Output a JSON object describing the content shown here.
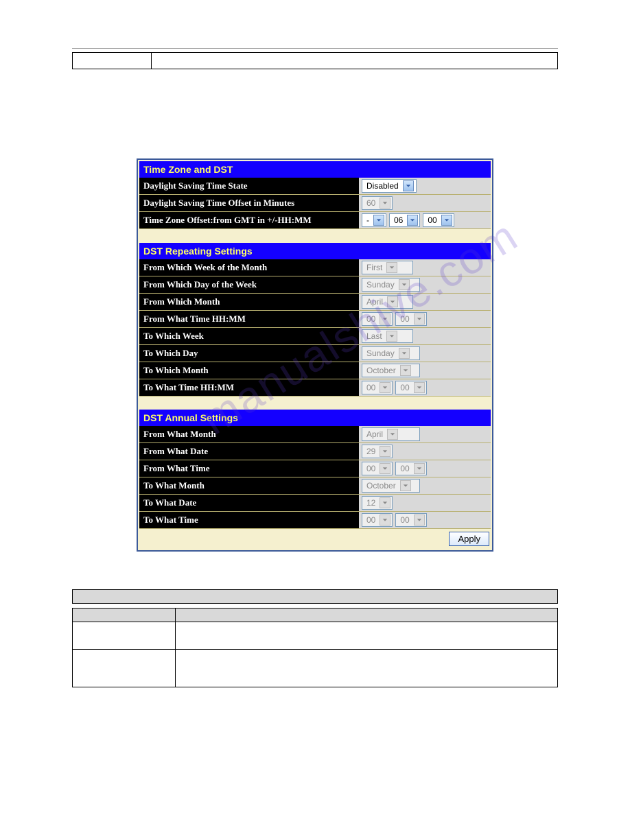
{
  "sections": {
    "tz": {
      "title": "Time Zone and DST",
      "rows": {
        "dst_state": {
          "label": "Daylight Saving Time State",
          "value": "Disabled"
        },
        "dst_offset": {
          "label": "Daylight Saving Time Offset in Minutes",
          "value": "60"
        },
        "tz_offset": {
          "label": "Time Zone Offset:from GMT in +/-HH:MM",
          "sign": "-",
          "hh": "06",
          "mm": "00"
        }
      }
    },
    "repeat": {
      "title": "DST Repeating Settings",
      "rows": {
        "from_week": {
          "label": "From Which Week of the Month",
          "value": "First"
        },
        "from_day": {
          "label": "From Which Day of the Week",
          "value": "Sunday"
        },
        "from_month": {
          "label": "From Which Month",
          "value": "April"
        },
        "from_time": {
          "label": "From What Time HH:MM",
          "hh": "00",
          "mm": "00"
        },
        "to_week": {
          "label": "To Which Week",
          "value": "Last"
        },
        "to_day": {
          "label": "To Which Day",
          "value": "Sunday"
        },
        "to_month": {
          "label": "To Which Month",
          "value": "October"
        },
        "to_time": {
          "label": "To What Time HH:MM",
          "hh": "00",
          "mm": "00"
        }
      }
    },
    "annual": {
      "title": "DST Annual Settings",
      "rows": {
        "from_month": {
          "label": "From What Month",
          "value": "April"
        },
        "from_date": {
          "label": "From What Date",
          "value": "29"
        },
        "from_time": {
          "label": "From What Time",
          "hh": "00",
          "mm": "00"
        },
        "to_month": {
          "label": "To What Month",
          "value": "October"
        },
        "to_date": {
          "label": "To What Date",
          "value": "12"
        },
        "to_time": {
          "label": "To What Time",
          "hh": "00",
          "mm": "00"
        }
      }
    }
  },
  "apply_label": "Apply",
  "watermark": "manualshive.com"
}
